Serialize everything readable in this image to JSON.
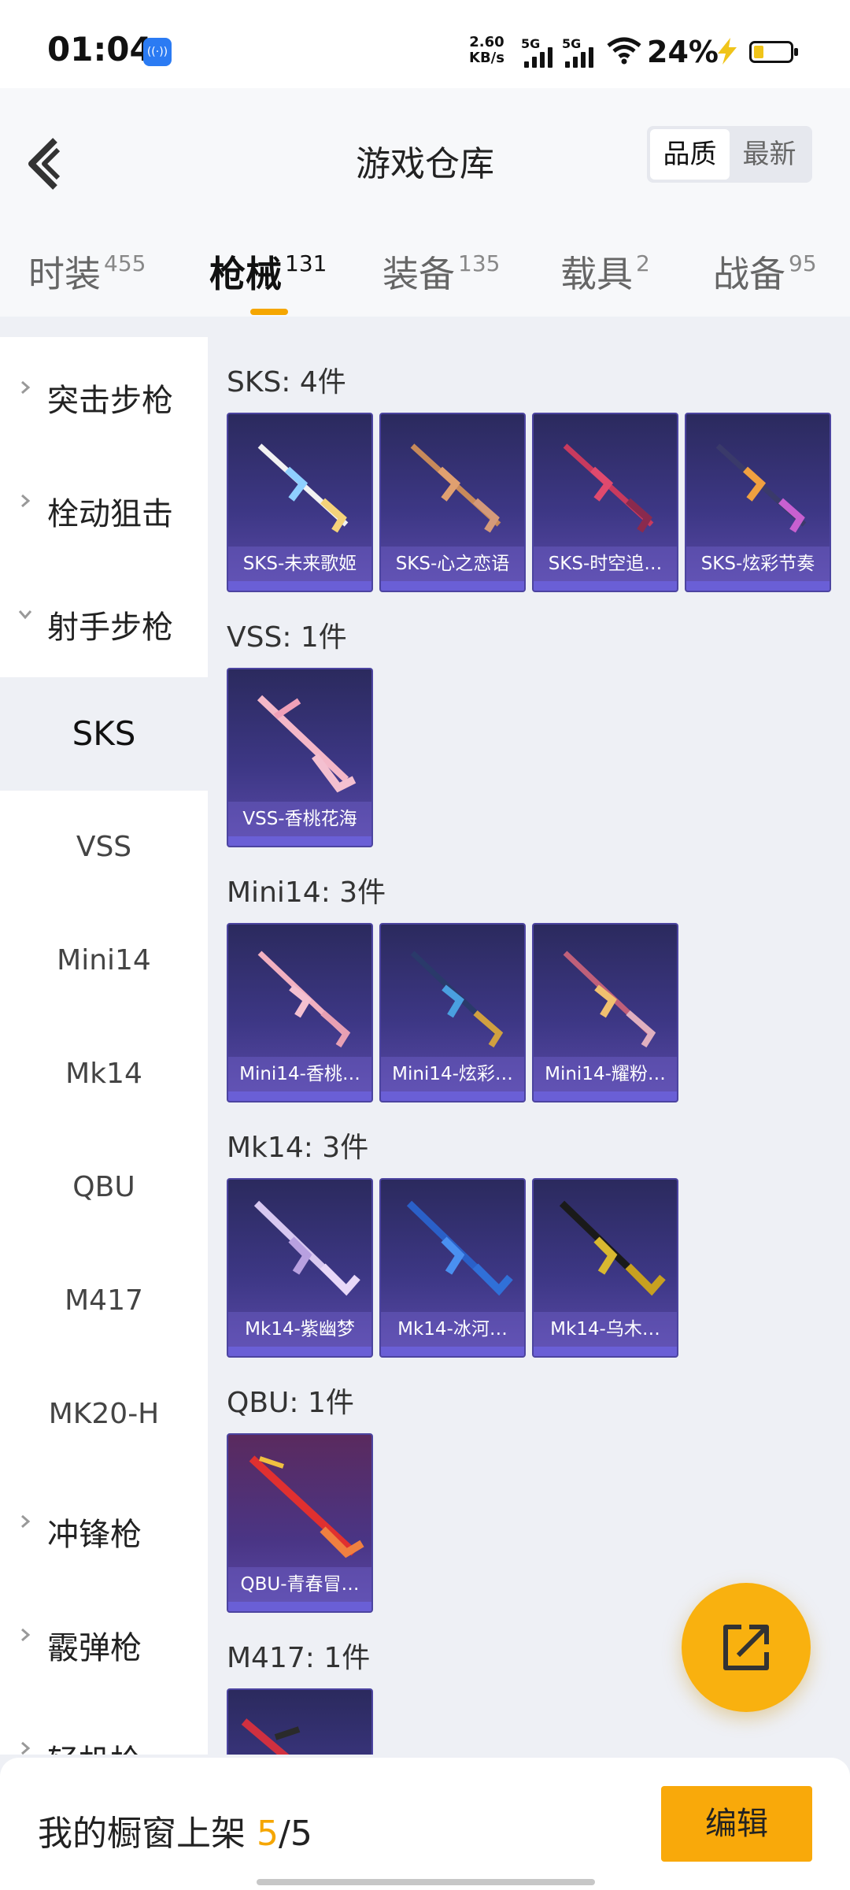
{
  "status_bar": {
    "time": "01:04",
    "badge": "((·))",
    "speed_value": "2.60",
    "speed_unit": "KB/s",
    "sim1": "5G",
    "sim2": "5G",
    "battery": "24%"
  },
  "header": {
    "title": "游戏仓库",
    "sort_options": [
      "品质",
      "最新"
    ],
    "sort_selected": "品质"
  },
  "tabs": [
    {
      "label": "时装",
      "count": "455"
    },
    {
      "label": "枪械",
      "count": "131"
    },
    {
      "label": "装备",
      "count": "135"
    },
    {
      "label": "载具",
      "count": "2"
    },
    {
      "label": "战备",
      "count": "95"
    }
  ],
  "active_tab": "枪械",
  "sidebar": {
    "categories": [
      "突击步枪",
      "栓动狙击",
      "射手步枪"
    ],
    "subs": [
      "SKS",
      "VSS",
      "Mini14",
      "Mk14",
      "QBU",
      "M417",
      "MK20-H"
    ],
    "after": [
      "冲锋枪",
      "霰弹枪",
      "轻机枪"
    ]
  },
  "sections": [
    {
      "title": "SKS: 4件",
      "items": [
        "SKS-未来歌姬",
        "SKS-心之恋语",
        "SKS-时空追…",
        "SKS-炫彩节奏"
      ]
    },
    {
      "title": "VSS: 1件",
      "items": [
        "VSS-香桃花海"
      ]
    },
    {
      "title": "Mini14: 3件",
      "items": [
        "Mini14-香桃…",
        "Mini14-炫彩…",
        "Mini14-耀粉…"
      ]
    },
    {
      "title": "Mk14: 3件",
      "items": [
        "Mk14-紫幽梦",
        "Mk14-冰河…",
        "Mk14-乌木…"
      ]
    },
    {
      "title": "QBU: 1件",
      "items": [
        "QBU-青春冒…"
      ]
    },
    {
      "title": "M417: 1件",
      "items": [
        ""
      ]
    }
  ],
  "bottom": {
    "showcase_label": "我的橱窗上架",
    "showcase_used": "5",
    "showcase_total": "/5",
    "edit_label": "编辑"
  },
  "colors": {
    "accent": "#f9a90a",
    "card_bg": "#3d3785",
    "card_label_bg": "#6e5fc8"
  },
  "icons": {
    "back": "chevron-left-icon",
    "fab": "share-external-icon"
  }
}
